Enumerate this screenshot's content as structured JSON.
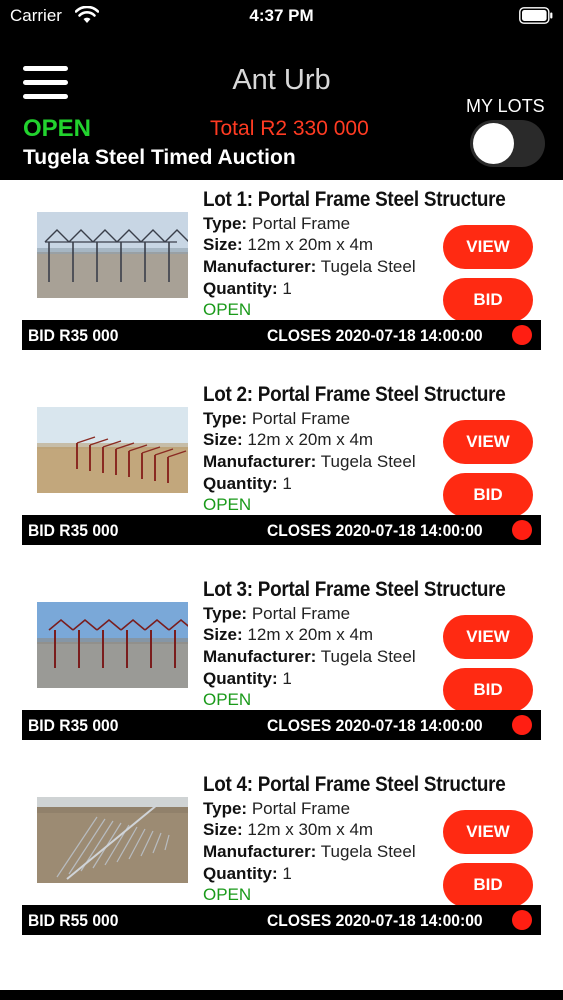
{
  "status_bar": {
    "carrier": "Carrier",
    "time": "4:37 PM"
  },
  "header": {
    "app_title": "Ant Urb",
    "auction_status": "OPEN",
    "total": "Total R2 330 000",
    "auction_name": "Tugela Steel Timed Auction",
    "my_lots_label": "MY LOTS",
    "my_lots_toggle_on": false
  },
  "colors": {
    "accent_red": "#ff2a12",
    "open_green": "#22d32e",
    "header_bg": "#000000"
  },
  "labels": {
    "type": "Type:",
    "size": "Size:",
    "manufacturer": "Manufacturer:",
    "quantity": "Quantity:",
    "view": "VIEW",
    "bid": "BID"
  },
  "lots": [
    {
      "title": "Lot 1: Portal Frame Steel Structure",
      "type": "Portal Frame",
      "size": "12m x 20m x 4m",
      "manufacturer": "Tugela Steel",
      "quantity": "1",
      "status": "OPEN",
      "bid": "BID R35 000",
      "closes": "CLOSES 2020-07-18 14:00:00"
    },
    {
      "title": "Lot 2: Portal Frame Steel Structure",
      "type": "Portal Frame",
      "size": "12m x 20m x 4m",
      "manufacturer": "Tugela Steel",
      "quantity": "1",
      "status": "OPEN",
      "bid": "BID R35 000",
      "closes": "CLOSES 2020-07-18 14:00:00"
    },
    {
      "title": "Lot 3: Portal Frame Steel Structure",
      "type": "Portal Frame",
      "size": "12m x 20m x 4m",
      "manufacturer": "Tugela Steel",
      "quantity": "1",
      "status": "OPEN",
      "bid": "BID R35 000",
      "closes": "CLOSES 2020-07-18 14:00:00"
    },
    {
      "title": "Lot 4: Portal Frame Steel Structure",
      "type": "Portal Frame",
      "size": "12m x 30m x 4m",
      "manufacturer": "Tugela Steel",
      "quantity": "1",
      "status": "OPEN",
      "bid": "BID R55 000",
      "closes": "CLOSES 2020-07-18 14:00:00"
    }
  ]
}
